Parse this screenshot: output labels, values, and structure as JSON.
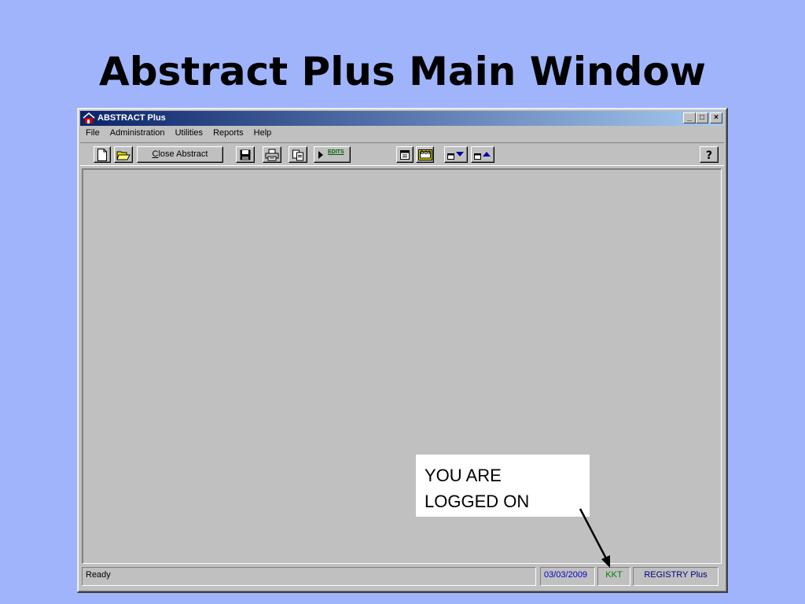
{
  "slide": {
    "title": "Abstract Plus Main Window"
  },
  "window": {
    "title": "ABSTRACT Plus",
    "controls": {
      "minimize": "_",
      "maximize": "□",
      "close": "×"
    }
  },
  "menu": [
    "File",
    "Administration",
    "Utilities",
    "Reports",
    "Help"
  ],
  "toolbar": {
    "close_abstract": {
      "mnemonic": "C",
      "rest": "lose Abstract"
    },
    "edits_label": "EDITS",
    "dos_label": "DOS",
    "icons": [
      "new-document-icon",
      "open-folder-icon",
      "save-disk-icon",
      "print-icon",
      "copy-icon",
      "run-edits-icon",
      "notepad-icon",
      "dos-icon",
      "window-down-icon",
      "window-up-icon",
      "help-icon"
    ]
  },
  "status": {
    "ready": "Ready",
    "date": "03/03/2009",
    "user": "KKT",
    "product": "REGISTRY Plus"
  },
  "callout": {
    "line1": "YOU ARE",
    "line2": "LOGGED ON"
  },
  "colors": {
    "background": "#a0b4fc",
    "titlebar_start": "#0a246a",
    "titlebar_end": "#a6caf0",
    "window_face": "#c0c0c0",
    "status_date": "#0000c8",
    "status_user": "#008000",
    "status_product": "#000080"
  }
}
